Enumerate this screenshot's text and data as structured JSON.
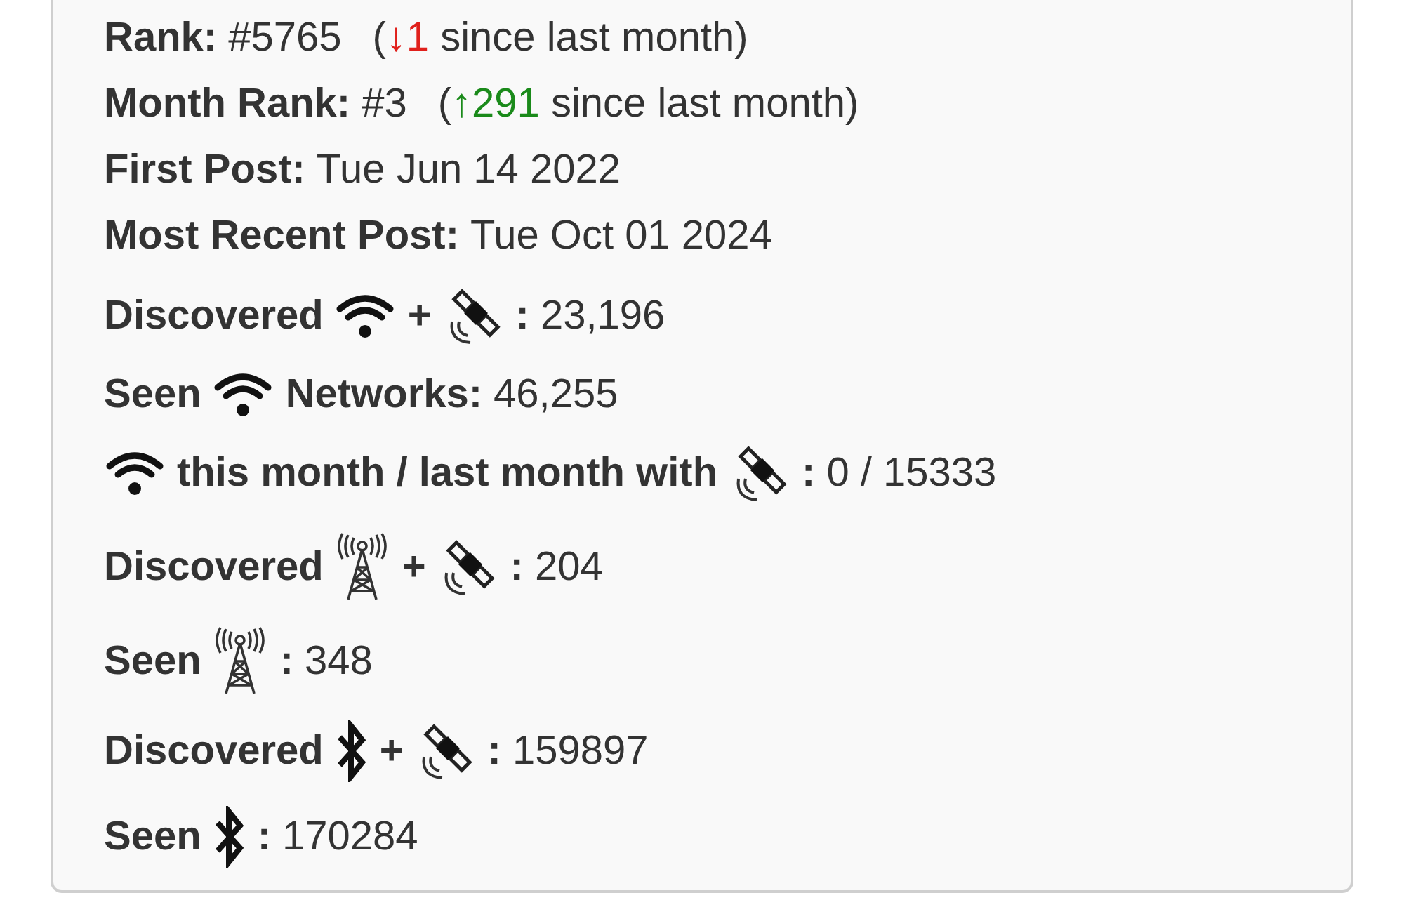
{
  "sections": [
    {
      "lines": [
        [
          {
            "kind": "label",
            "text": "Rank:"
          },
          {
            "kind": "value",
            "text": "#5765"
          },
          {
            "kind": "change",
            "prefix": "(",
            "text": "↓1",
            "color": "#e0201b",
            "suffix": " since last month)"
          }
        ],
        [
          {
            "kind": "label",
            "text": "Month Rank:"
          },
          {
            "kind": "value",
            "text": "#3"
          },
          {
            "kind": "change",
            "prefix": "(",
            "text": "↑291",
            "color": "#1a8a1a",
            "suffix": " since last month)"
          }
        ],
        [
          {
            "kind": "label",
            "text": "First Post:"
          },
          {
            "kind": "value",
            "text": "Tue Jun 14 2022"
          }
        ],
        [
          {
            "kind": "label",
            "text": "Most Recent Post:"
          },
          {
            "kind": "value",
            "text": "Tue Oct 01 2024"
          }
        ]
      ]
    },
    {
      "lines": [
        [
          {
            "kind": "label",
            "text": "Discovered"
          },
          {
            "kind": "wifi"
          },
          {
            "kind": "label",
            "text": "+"
          },
          {
            "kind": "satellite"
          },
          {
            "kind": "label",
            "text": ":"
          },
          {
            "kind": "value",
            "text": "23,196"
          }
        ],
        [
          {
            "kind": "label",
            "text": "Seen"
          },
          {
            "kind": "wifi"
          },
          {
            "kind": "label",
            "text": "Networks:"
          },
          {
            "kind": "value",
            "text": "46,255"
          }
        ],
        [
          {
            "kind": "wifi"
          },
          {
            "kind": "label",
            "text": "this month / last month with"
          },
          {
            "kind": "satellite"
          },
          {
            "kind": "label",
            "text": ":"
          },
          {
            "kind": "value",
            "text": "0 / 15333"
          }
        ]
      ]
    },
    {
      "lines": [
        [
          {
            "kind": "label",
            "text": "Discovered"
          },
          {
            "kind": "tower"
          },
          {
            "kind": "label",
            "text": "+"
          },
          {
            "kind": "satellite"
          },
          {
            "kind": "label",
            "text": ":"
          },
          {
            "kind": "value",
            "text": "204"
          }
        ],
        [
          {
            "kind": "label",
            "text": "Seen"
          },
          {
            "kind": "tower"
          },
          {
            "kind": "label",
            "text": ":"
          },
          {
            "kind": "value",
            "text": "348"
          }
        ],
        [
          {
            "kind": "label",
            "text": "Discovered"
          },
          {
            "kind": "bluetooth"
          },
          {
            "kind": "label",
            "text": "+"
          },
          {
            "kind": "satellite"
          },
          {
            "kind": "label",
            "text": ":"
          },
          {
            "kind": "value",
            "text": "159897"
          }
        ],
        [
          {
            "kind": "label",
            "text": "Seen"
          },
          {
            "kind": "bluetooth"
          },
          {
            "kind": "label",
            "text": ":"
          },
          {
            "kind": "value",
            "text": "170284"
          }
        ]
      ]
    }
  ]
}
